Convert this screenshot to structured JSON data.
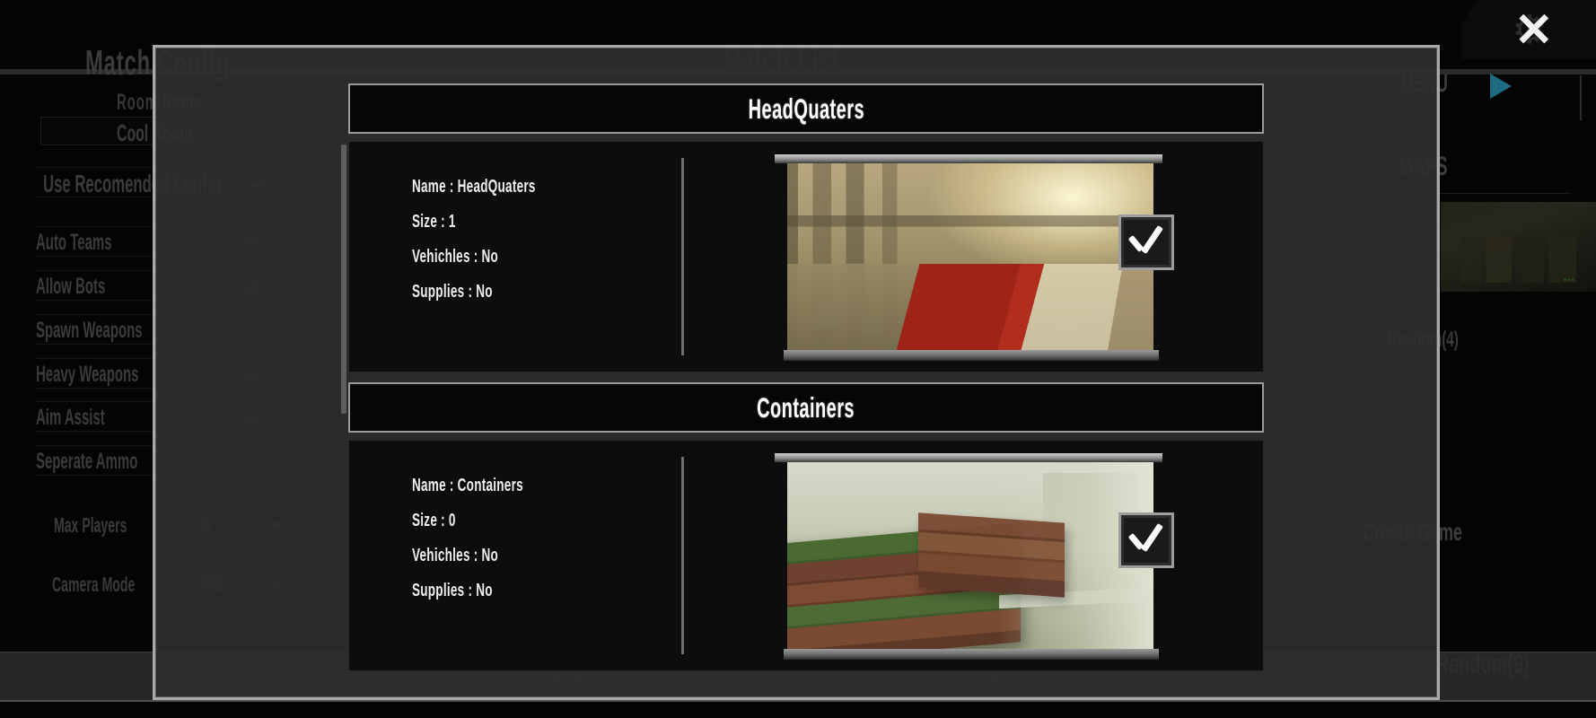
{
  "background": {
    "match_config_title": "Match Config",
    "match_list_title": "Match List",
    "room_name_label": "Room Name",
    "room_name_value": "Cool Room",
    "toggles": [
      {
        "label": "Use Recomended Config",
        "checked": true
      },
      {
        "label": "Auto Teams",
        "checked": true
      },
      {
        "label": "Allow Bots",
        "checked": true
      },
      {
        "label": "Spawn Weapons",
        "checked": false
      },
      {
        "label": "Heavy Weapons",
        "checked": true
      },
      {
        "label": "Aim Assist",
        "checked": true
      },
      {
        "label": "Seperate Ammo",
        "checked": false
      }
    ],
    "selectors": [
      {
        "label": "Max Players",
        "value": "10"
      },
      {
        "label": "Camera Mode",
        "value": "FPS"
      }
    ],
    "menu_label": "MENU",
    "maps_label": "MAPS",
    "map_random_4": "Random(4)",
    "map_random_9": "Random(9)",
    "create_game_label": "Create Game",
    "manual_ip_label": "Manual IP",
    "london_label": "London",
    "thumb_dots": "•••",
    "accent_color": "#1c6b80"
  },
  "close_button": {
    "icon": "close-icon",
    "glyph": "✕",
    "gear_glyph": "⚙"
  },
  "modal": {
    "cards": [
      {
        "title": "HeadQuaters",
        "name_line": "Name : HeadQuaters",
        "size_line": "Size : 1",
        "vehicles_line": "Vehichles : No",
        "supplies_line": "Supplies : No",
        "selected": true
      },
      {
        "title": "Containers",
        "name_line": "Name : Containers",
        "size_line": "Size : 0",
        "vehicles_line": "Vehichles : No",
        "supplies_line": "Supplies : No",
        "selected": true
      }
    ]
  }
}
